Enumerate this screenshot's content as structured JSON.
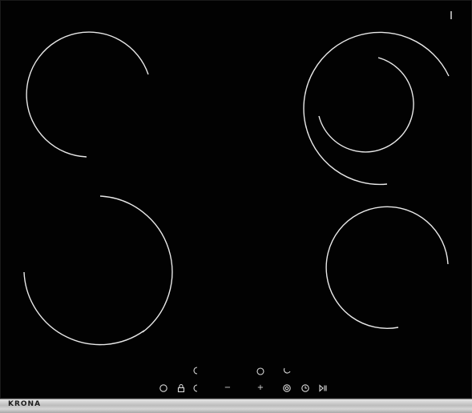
{
  "brand": {
    "name": "KRONA"
  },
  "colors": {
    "glass": "#020202",
    "marking": "#e8e8e8",
    "frame": "#c8c8c8"
  },
  "zones": [
    {
      "id": "front-left",
      "type": "single"
    },
    {
      "id": "rear-left",
      "type": "single"
    },
    {
      "id": "rear-right",
      "type": "dual"
    },
    {
      "id": "front-right",
      "type": "single"
    }
  ],
  "controls": {
    "minus_symbol": "−",
    "plus_symbol": "+",
    "icons": [
      "power-icon",
      "lock-icon",
      "zone-select-icon",
      "minus-icon",
      "plus-icon",
      "dual-zone-icon",
      "timer-icon",
      "play-pause-icon"
    ]
  }
}
